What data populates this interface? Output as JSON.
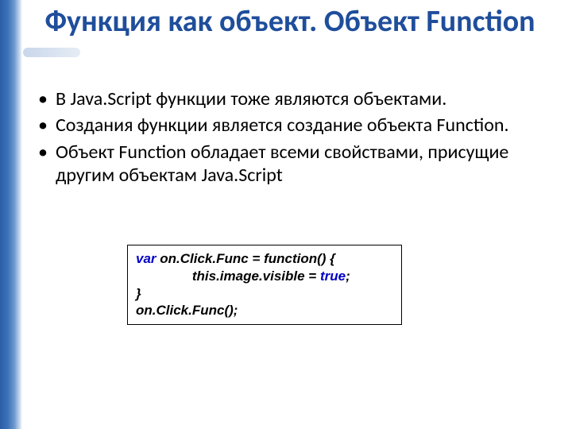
{
  "title": "Функция как объект. Объект Function",
  "bullets": [
    "В Java.Script функции тоже являются объектами.",
    "Создания функции является создание объекта Function.",
    "Объект Function обладает всеми свойствами, присущие другим объектам Java.Script"
  ],
  "code": {
    "kw_var": "var",
    "decl_rest": " on.Click.Func = function() {",
    "indent": "               ",
    "body_pre": "this.image.visible = ",
    "bool_true": "true",
    "body_post": ";",
    "close": "}",
    "call": "on.Click.Func();"
  }
}
